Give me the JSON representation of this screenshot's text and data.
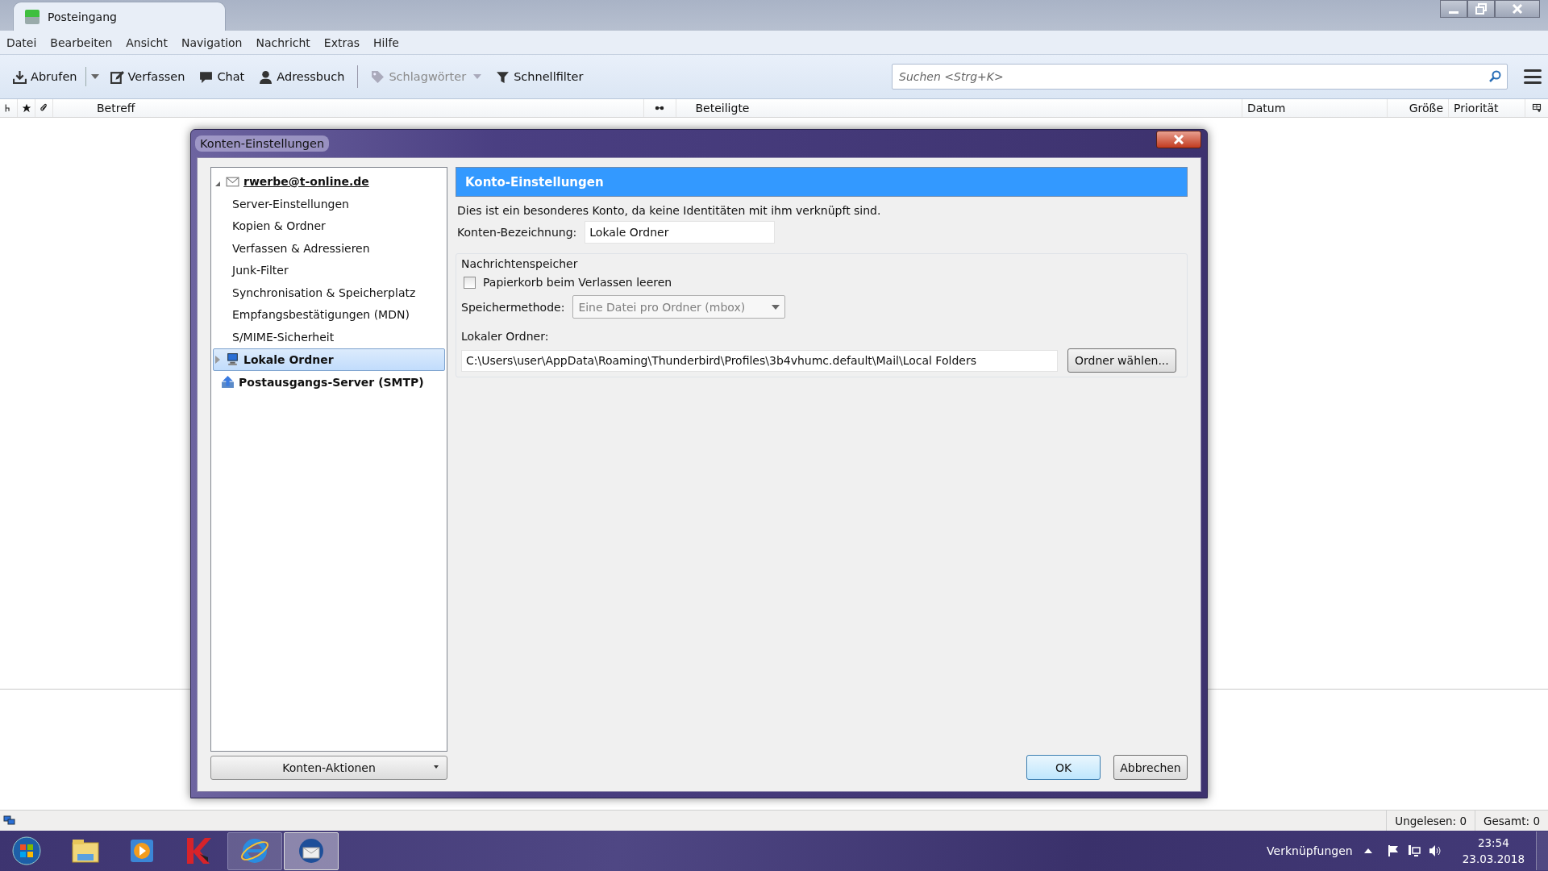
{
  "window": {
    "tab_title": "Posteingang"
  },
  "menu": [
    "Datei",
    "Bearbeiten",
    "Ansicht",
    "Navigation",
    "Nachricht",
    "Extras",
    "Hilfe"
  ],
  "toolbar": [
    {
      "kind": "split",
      "label": "Abrufen",
      "disabled": false
    },
    {
      "kind": "button",
      "label": "Verfassen",
      "disabled": false
    },
    {
      "kind": "button",
      "label": "Chat",
      "disabled": false
    },
    {
      "kind": "button",
      "label": "Adressbuch",
      "disabled": false
    },
    {
      "kind": "separator"
    },
    {
      "kind": "dropdown",
      "label": "Schlagwörter",
      "disabled": true
    },
    {
      "kind": "button",
      "label": "Schnellfilter",
      "disabled": false
    }
  ],
  "search": {
    "placeholder": "Suchen <Strg+K>"
  },
  "columns": [
    {
      "kind": "icon"
    },
    {
      "kind": "icon"
    },
    {
      "kind": "icon"
    },
    {
      "kind": "text",
      "label": "Betreff"
    },
    {
      "kind": "icon"
    },
    {
      "kind": "text",
      "label": "Beteiligte"
    },
    {
      "kind": "text",
      "label": "Datum"
    },
    {
      "kind": "text",
      "label": "Größe"
    },
    {
      "kind": "text",
      "label": "Priorität"
    },
    {
      "kind": "icon"
    }
  ],
  "dialog": {
    "title": "Konten-Einstellungen",
    "tree": [
      {
        "kind": "account",
        "label": "rwerbe@t-online.de",
        "expanded": true,
        "selected": false,
        "children": [
          {
            "label": "Server-Einstellungen"
          },
          {
            "label": "Kopien & Ordner"
          },
          {
            "label": "Verfassen & Adressieren"
          },
          {
            "label": "Junk-Filter"
          },
          {
            "label": "Synchronisation & Speicherplatz"
          },
          {
            "label": "Empfangsbestätigungen (MDN)"
          },
          {
            "label": "S/MIME-Sicherheit"
          }
        ]
      },
      {
        "kind": "local",
        "label": "Lokale Ordner",
        "expanded": false,
        "selected": true
      },
      {
        "kind": "smtp",
        "label": "Postausgangs-Server (SMTP)",
        "selected": false
      }
    ],
    "actions_button": "Konten-Aktionen",
    "panel_title": "Konto-Einstellungen",
    "description": "Dies ist ein besonderes Konto, da keine Identitäten mit ihm verknüpft sind.",
    "name_label": "Konten-Bezeichnung:",
    "name_value": "Lokale Ordner",
    "group_title": "Nachrichtenspeicher",
    "checkbox": {
      "label": "Papierkorb beim Verlassen leeren",
      "checked": false
    },
    "method_label": "Speichermethode:",
    "method_value": "Eine Datei pro Ordner (mbox)",
    "method_disabled": true,
    "folder_label": "Lokaler Ordner:",
    "folder_value": "C:\\Users\\user\\AppData\\Roaming\\Thunderbird\\Profiles\\3b4vhumc.default\\Mail\\Local Folders",
    "choose_button": "Ordner wählen...",
    "buttons": [
      {
        "label": "OK",
        "default": true
      },
      {
        "label": "Abbrechen",
        "default": false
      }
    ]
  },
  "status_bar": {
    "unread": "Ungelesen: 0",
    "total": "Gesamt: 0"
  },
  "taskbar": {
    "apps": [
      {
        "selected": false,
        "running": false
      },
      {
        "selected": false,
        "running": false
      },
      {
        "selected": false,
        "running": false
      },
      {
        "selected": false,
        "running": true
      },
      {
        "selected": true,
        "running": true
      }
    ],
    "toolbar_label": "Verknüpfungen",
    "time": "23:54",
    "date": "23.03.2018"
  }
}
